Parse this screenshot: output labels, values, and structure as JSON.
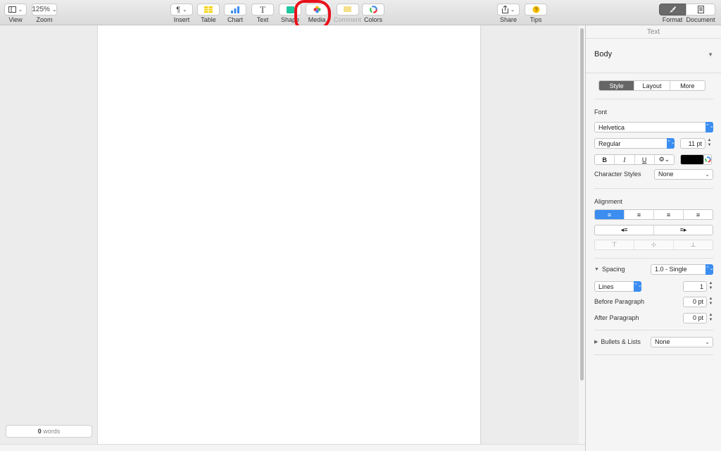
{
  "toolbar": {
    "view": {
      "label": "View"
    },
    "zoom": {
      "label": "Zoom",
      "value": "125%"
    },
    "insert": {
      "label": "Insert",
      "glyph": "¶"
    },
    "table": {
      "label": "Table"
    },
    "chart": {
      "label": "Chart"
    },
    "text": {
      "label": "Text",
      "glyph": "T"
    },
    "shape": {
      "label": "Shape"
    },
    "media": {
      "label": "Media"
    },
    "comment": {
      "label": "Comment"
    },
    "colors": {
      "label": "Colors"
    },
    "share": {
      "label": "Share"
    },
    "tips": {
      "label": "Tips"
    },
    "format": {
      "label": "Format"
    },
    "document": {
      "label": "Document"
    }
  },
  "status": {
    "word_count": "0",
    "word_label": "words"
  },
  "inspector": {
    "title": "Text",
    "paragraph_style": "Body",
    "tabs": [
      "Style",
      "Layout",
      "More"
    ],
    "font": {
      "heading": "Font",
      "family": "Helvetica",
      "typeface": "Regular",
      "size": "11 pt",
      "bold": "B",
      "italic": "I",
      "underline": "U"
    },
    "character_styles": {
      "label": "Character Styles",
      "value": "None"
    },
    "alignment": {
      "heading": "Alignment"
    },
    "spacing": {
      "label": "Spacing",
      "value": "1.0 - Single",
      "lines_label": "Lines",
      "lines_value": "1",
      "before_label": "Before Paragraph",
      "before_value": "0 pt",
      "after_label": "After Paragraph",
      "after_value": "0 pt"
    },
    "bullets": {
      "label": "Bullets & Lists",
      "value": "None"
    }
  },
  "colors": {
    "accent": "#3b8df0",
    "annotation": "#e8101a",
    "text_color": "#000000"
  }
}
